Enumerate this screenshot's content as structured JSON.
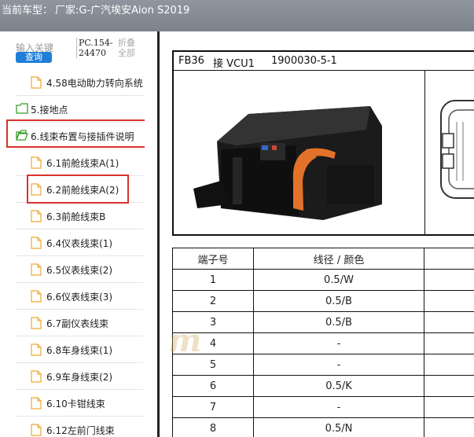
{
  "title_bar": {
    "label": "当前车型：",
    "vehicle": "厂家:G-广汽埃安Aion S2019"
  },
  "sidebar": {
    "search_placeholder": "输入关键",
    "search_button": "查询",
    "pc_code": "PC.154-24470",
    "collapse_label": "折叠全部",
    "items": [
      {
        "label": "4.58电动助力转向系统",
        "kind": "file"
      },
      {
        "label": "5.接地点",
        "kind": "folder"
      },
      {
        "label": "6.线束布置与接插件说明",
        "kind": "folder-open"
      },
      {
        "label": "6.1前舱线束A(1)",
        "kind": "file"
      },
      {
        "label": "6.2前舱线束A(2)",
        "kind": "file"
      },
      {
        "label": "6.3前舱线束B",
        "kind": "file"
      },
      {
        "label": "6.4仪表线束(1)",
        "kind": "file"
      },
      {
        "label": "6.5仪表线束(2)",
        "kind": "file"
      },
      {
        "label": "6.6仪表线束(3)",
        "kind": "file"
      },
      {
        "label": "6.7副仪表线束",
        "kind": "file"
      },
      {
        "label": "6.8车身线束(1)",
        "kind": "file"
      },
      {
        "label": "6.9车身线束(2)",
        "kind": "file"
      },
      {
        "label": "6.10卡钳线束",
        "kind": "file"
      },
      {
        "label": "6.12左前门线束",
        "kind": "file"
      }
    ]
  },
  "document": {
    "connector_code": "FB36",
    "connector_name": "接 VCU1",
    "part_number": "1900030-5-1",
    "columns": [
      "端子号",
      "线径 / 颜色",
      ""
    ],
    "rows": [
      {
        "pin": "1",
        "wire": "0.5/W"
      },
      {
        "pin": "2",
        "wire": "0.5/B"
      },
      {
        "pin": "3",
        "wire": "0.5/B"
      },
      {
        "pin": "4",
        "wire": "-"
      },
      {
        "pin": "5",
        "wire": "-"
      },
      {
        "pin": "6",
        "wire": "0.5/K"
      },
      {
        "pin": "7",
        "wire": "-"
      },
      {
        "pin": "8",
        "wire": "0.5/N"
      }
    ]
  },
  "colors": {
    "highlight": "#d9322d",
    "search_button": "#1f7fd8",
    "file_icon": "#f0a830",
    "folder_icon": "#3a9a2e",
    "title_bar": "#858c95"
  }
}
